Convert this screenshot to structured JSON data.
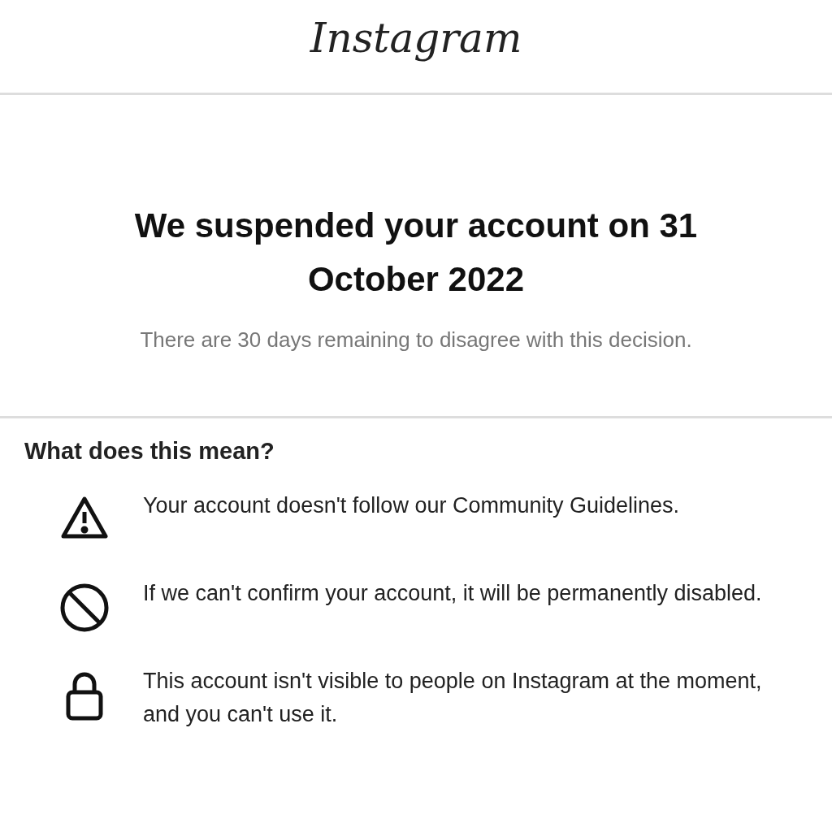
{
  "header": {
    "logo": "Instagram"
  },
  "notice": {
    "title": "We suspended your account on 31 October 2022",
    "subtitle": "There are 30 days remaining to disagree with this decision."
  },
  "section": {
    "heading": "What does this mean?",
    "items": [
      {
        "kind": "warning",
        "text": "Your account doesn't follow our Community Guidelines."
      },
      {
        "kind": "blocked",
        "text": "If we can't confirm your account, it will be permanently disabled."
      },
      {
        "kind": "lock",
        "text": "This account isn't visible to people on Instagram at the moment, and you can't use it."
      }
    ]
  }
}
